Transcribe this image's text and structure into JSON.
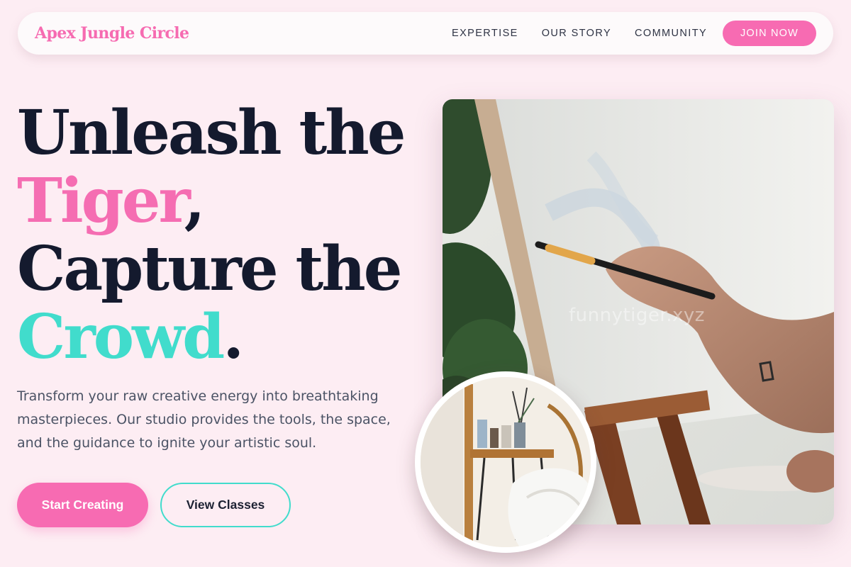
{
  "nav": {
    "brand": "Apex Jungle Circle",
    "links": [
      "EXPERTISE",
      "OUR STORY",
      "COMMUNITY"
    ],
    "cta": "JOIN NOW"
  },
  "hero": {
    "line1": "Unleash the",
    "line2_highlight": "Tiger",
    "line2_suffix": ",",
    "line3": "Capture the",
    "line4_highlight": "Crowd",
    "line4_suffix": ".",
    "description": "Transform your raw creative energy into breathtaking masterpieces. Our studio provides the tools, the space, and the guidance to ignite your artistic soul.",
    "primary_button": "Start Creating",
    "secondary_button": "View Classes"
  },
  "media": {
    "watermark": "funnytiger.xyz"
  },
  "colors": {
    "background": "#fdedf3",
    "accent_pink": "#f76bb2",
    "accent_teal": "#41dccc",
    "heading": "#141a2e"
  }
}
